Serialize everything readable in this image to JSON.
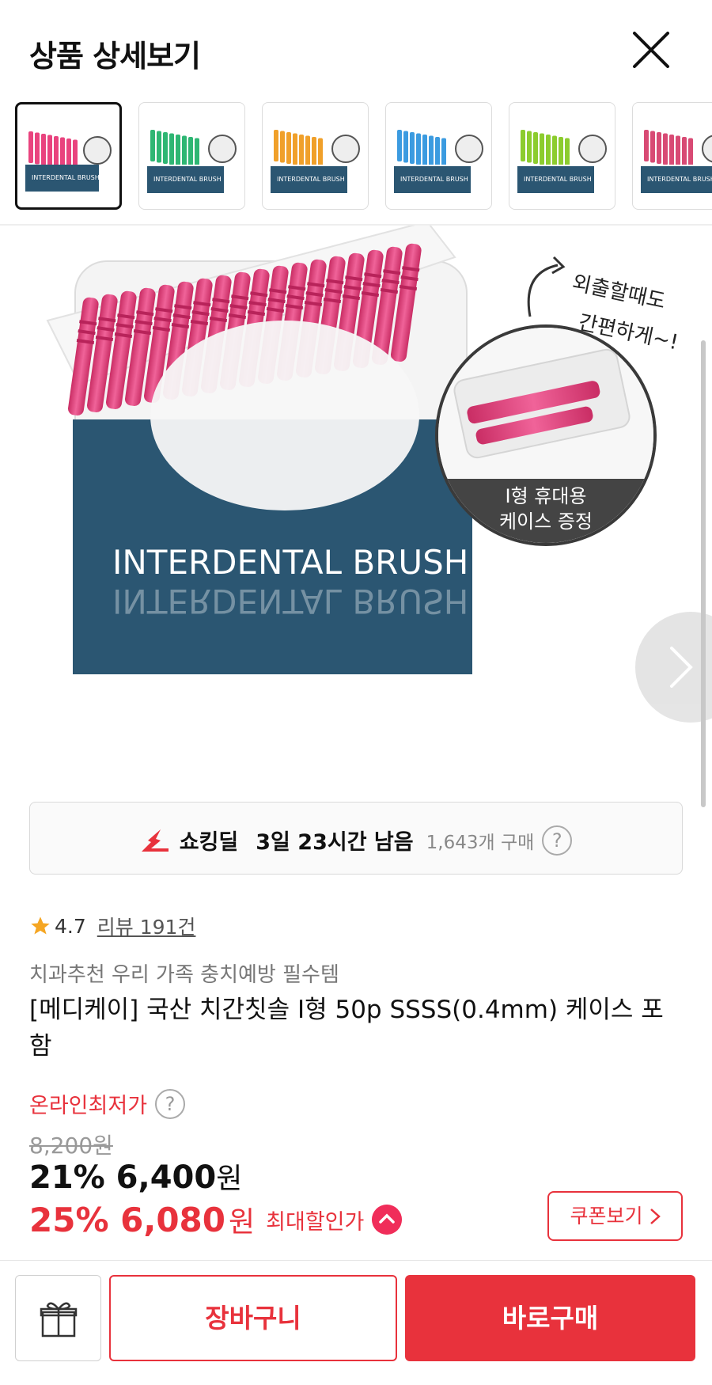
{
  "header": {
    "title": "상품 상세보기",
    "close_icon": "close-icon"
  },
  "thumbnails": [
    {
      "label": "INTERDENTAL BRUSH",
      "color": "#e9437e",
      "active": true
    },
    {
      "label": "INTERDENTAL BRUSH",
      "color": "#2eb673",
      "active": false
    },
    {
      "label": "INTERDENTAL BRUSH",
      "color": "#f0a02a",
      "active": false
    },
    {
      "label": "INTERDENTAL BRUSH",
      "color": "#3b9be0",
      "active": false
    },
    {
      "label": "INTERDENTAL BRUSH",
      "color": "#8ccc2e",
      "active": false
    },
    {
      "label": "INTERDENTAL BRUSH",
      "color": "#d84a74",
      "active": false
    }
  ],
  "hero": {
    "box_text": "INTERDENTAL BRUSH",
    "callout_line1": "외출할때도",
    "callout_line2": "간편하게~!",
    "badge_line1": "I형 휴대용",
    "badge_line2": "케이스 증정",
    "accent_color": "#e9437e",
    "box_color": "#2b5672"
  },
  "deal": {
    "label": "쇼킹딜",
    "time_left": "3일 23시간 남음",
    "buyers": "1,643개 구매",
    "help_icon": "?"
  },
  "rating": {
    "score": "4.7",
    "review_link": "리뷰 191건"
  },
  "product": {
    "subtitle": "치과추천 우리 가족 충치예방 필수템",
    "name": "[메디케이] 국산 치간칫솔 I형 50p SSSS(0.4mm) 케이스 포함"
  },
  "price": {
    "label": "온라인최저가",
    "help_icon": "?",
    "original": "8,200원",
    "sale_percent_amount": "21% 6,400",
    "sale_won": "원",
    "max_percent_amount": "25% 6,080",
    "max_won": "원",
    "max_label": "최대할인가",
    "coupon_button": "쿠폰보기"
  },
  "bottom_bar": {
    "cart": "장바구니",
    "buy": "바로구매"
  },
  "colors": {
    "accent_red": "#e8323c",
    "text_dark": "#111111",
    "text_gray": "#777777"
  }
}
